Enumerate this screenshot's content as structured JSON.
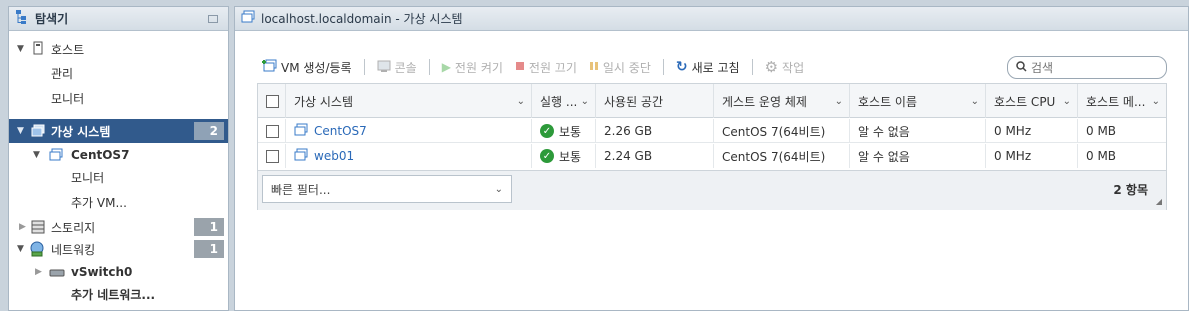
{
  "navigator": {
    "title": "탐색기",
    "tree": [
      {
        "label": "호스트"
      },
      {
        "label": "관리"
      },
      {
        "label": "모니터"
      },
      {
        "label": "가상 시스템",
        "badge": "2"
      },
      {
        "label": "CentOS7"
      },
      {
        "label": "모니터"
      },
      {
        "label": "추가 VM..."
      },
      {
        "label": "스토리지",
        "badge": "1"
      },
      {
        "label": "네트워킹",
        "badge": "1"
      },
      {
        "label": "vSwitch0"
      },
      {
        "label": "추가 네트워크..."
      }
    ]
  },
  "main": {
    "title": "localhost.localdomain - 가상 시스템",
    "toolbar": {
      "create": "VM 생성/등록",
      "console": "콘솔",
      "power_on": "전원 켜기",
      "power_off": "전원 끄기",
      "suspend": "일시 중단",
      "refresh": "새로 고침",
      "actions": "작업"
    },
    "search": {
      "placeholder": "검색"
    },
    "table": {
      "columns": [
        "가상 시스템",
        "실행 ...",
        "사용된 공간",
        "게스트 운영 체제",
        "호스트 이름",
        "호스트 CPU",
        "호스트 메..."
      ],
      "rows": [
        {
          "name": "CentOS7",
          "status": "보통",
          "space": "2.26 GB",
          "os": "CentOS 7(64비트)",
          "hostname": "알 수 없음",
          "cpu": "0 MHz",
          "mem": "0 MB"
        },
        {
          "name": "web01",
          "status": "보통",
          "space": "2.24 GB",
          "os": "CentOS 7(64비트)",
          "hostname": "알 수 없음",
          "cpu": "0 MHz",
          "mem": "0 MB"
        }
      ],
      "filter_placeholder": "빠른 필터...",
      "item_count": "2 항목"
    }
  },
  "colors": {
    "accent": "#315a8c",
    "link": "#2a69b8",
    "ok": "#2d9a3a"
  }
}
